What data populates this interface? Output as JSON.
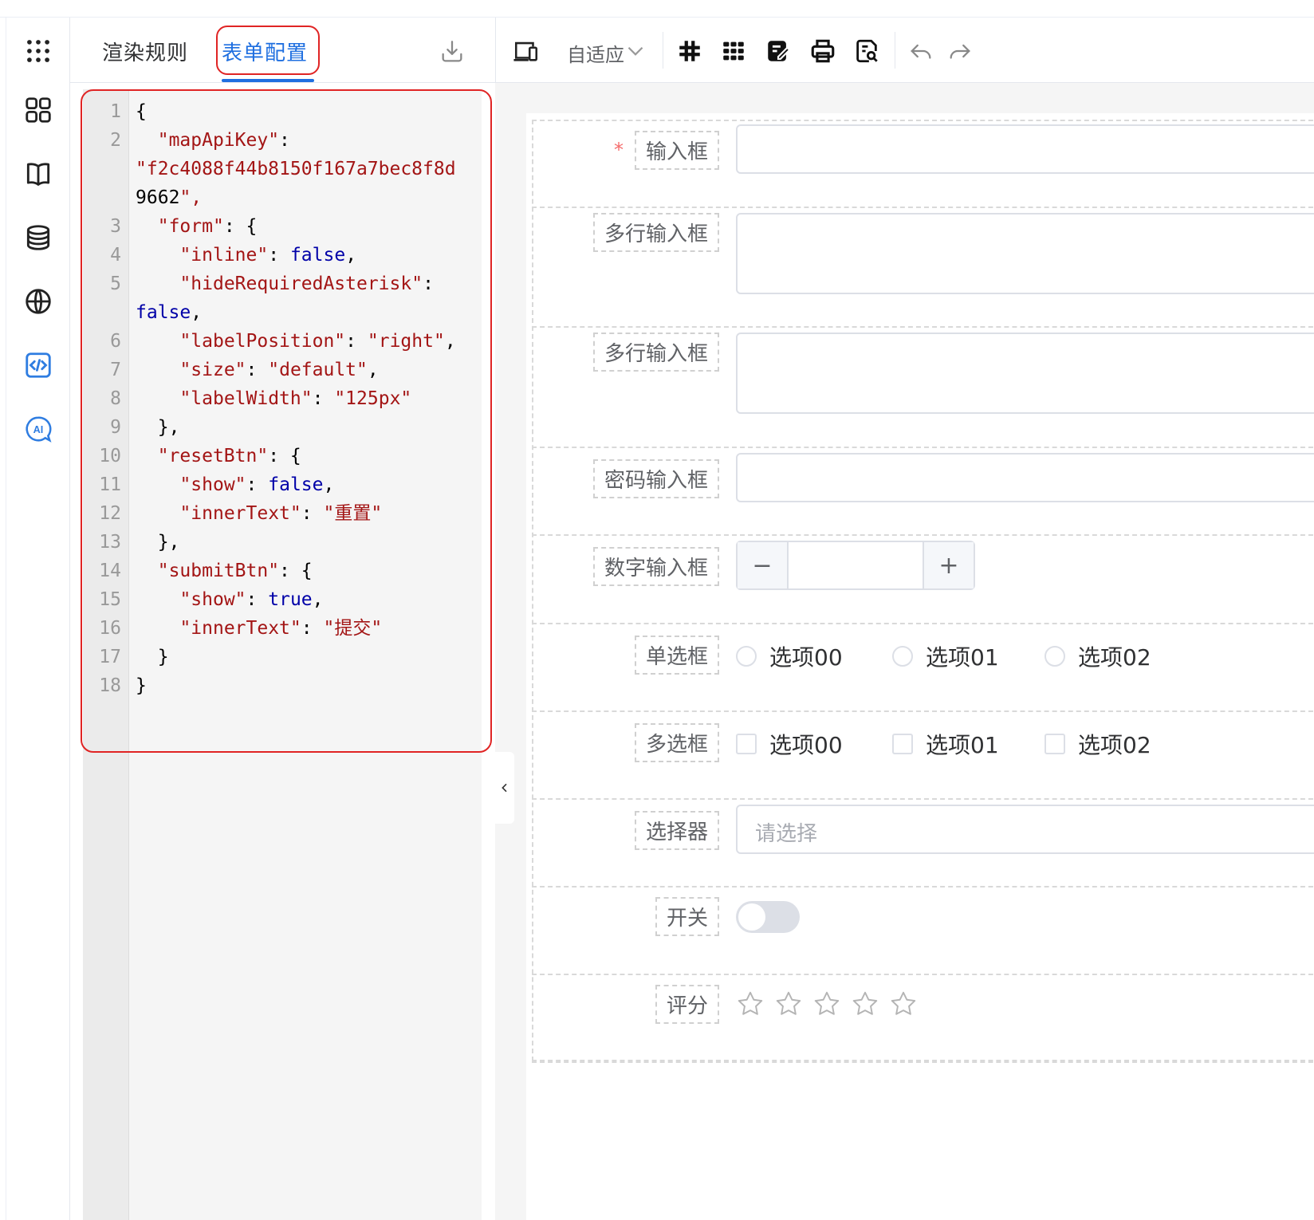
{
  "tabs": {
    "render_rules": "渲染规则",
    "form_config": "表单配置"
  },
  "toolbar": {
    "device_mode": "自适应"
  },
  "code_lines": [
    {
      "n": "1",
      "html": "{"
    },
    {
      "n": "2",
      "html": "  \"mapApiKey\":"
    },
    {
      "n": "",
      "html": "\"f2c4088f44b8150f167a7bec8f8d"
    },
    {
      "n": "",
      "html": "9662\","
    },
    {
      "n": "3",
      "html": "  \"form\": {"
    },
    {
      "n": "4",
      "html": "    \"inline\": false,"
    },
    {
      "n": "5",
      "html": "    \"hideRequiredAsterisk\":"
    },
    {
      "n": "",
      "html": "false,"
    },
    {
      "n": "6",
      "html": "    \"labelPosition\": \"right\","
    },
    {
      "n": "7",
      "html": "    \"size\": \"default\","
    },
    {
      "n": "8",
      "html": "    \"labelWidth\": \"125px\""
    },
    {
      "n": "9",
      "html": "  },"
    },
    {
      "n": "10",
      "html": "  \"resetBtn\": {"
    },
    {
      "n": "11",
      "html": "    \"show\": false,"
    },
    {
      "n": "12",
      "html": "    \"innerText\": \"重置\""
    },
    {
      "n": "13",
      "html": "  },"
    },
    {
      "n": "14",
      "html": "  \"submitBtn\": {"
    },
    {
      "n": "15",
      "html": "    \"show\": true,"
    },
    {
      "n": "16",
      "html": "    \"innerText\": \"提交\""
    },
    {
      "n": "17",
      "html": "  }"
    },
    {
      "n": "18",
      "html": "}"
    }
  ],
  "form": {
    "input_label": "输入框",
    "required_mark": "*",
    "textarea1_label": "多行输入框",
    "textarea2_label": "多行输入框",
    "password_label": "密码输入框",
    "number_label": "数字输入框",
    "number_minus": "−",
    "number_plus": "+",
    "radio_label": "单选框",
    "radio_options": [
      "选项00",
      "选项01",
      "选项02"
    ],
    "checkbox_label": "多选框",
    "checkbox_options": [
      "选项00",
      "选项01",
      "选项02"
    ],
    "select_label": "选择器",
    "select_placeholder": "请选择",
    "switch_label": "开关",
    "rate_label": "评分",
    "rate_value": 0,
    "rate_max": 5
  },
  "colors": {
    "accent": "#1f6fe0",
    "highlight_border": "#e02424",
    "sidebar_active": "#2f7de1"
  }
}
